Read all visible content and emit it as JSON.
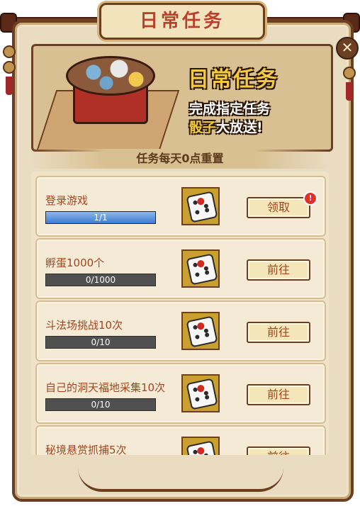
{
  "window": {
    "title": "日常任务",
    "close_icon": "close-icon"
  },
  "banner": {
    "title": "日常任务",
    "line1": "完成指定任务",
    "line2_highlight": "骰子",
    "line2_rest": "大放送!"
  },
  "reset_notice": "任务每天0点重置",
  "tasks": [
    {
      "name": "登录游戏",
      "progress_text": "1/1",
      "progress": 1.0,
      "button": "领取",
      "has_alert": true
    },
    {
      "name": "孵蛋1000个",
      "progress_text": "0/1000",
      "progress": 0.0,
      "button": "前往",
      "has_alert": false
    },
    {
      "name": "斗法场挑战10次",
      "progress_text": "0/10",
      "progress": 0.0,
      "button": "前往",
      "has_alert": false
    },
    {
      "name": "自己的洞天福地采集10次",
      "progress_text": "0/10",
      "progress": 0.0,
      "button": "前往",
      "has_alert": false
    },
    {
      "name": "秘境悬赏抓捕5次",
      "progress_text": "",
      "progress": 0.0,
      "button": "前往",
      "has_alert": false
    }
  ],
  "alert_badge": "!",
  "colors": {
    "frame": "#6a3f22",
    "title_text": "#b9412a",
    "gold_text": "#f3c93e",
    "progress_fill": "#3d7cd1",
    "progress_empty": "#505050",
    "task_text": "#a0461f"
  }
}
